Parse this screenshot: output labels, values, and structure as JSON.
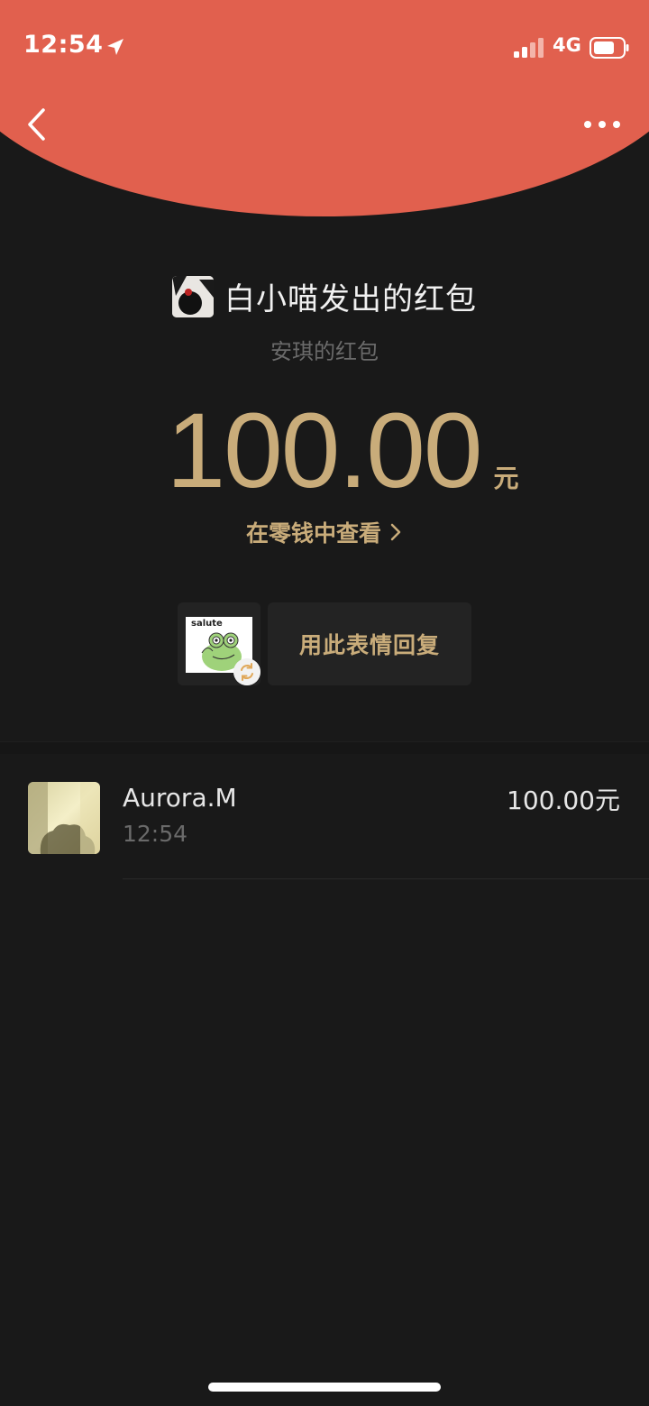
{
  "status_bar": {
    "time": "12:54",
    "network": "4G"
  },
  "nav": {
    "back_icon": "chevron-left-icon",
    "more_icon": "more-horizontal-icon"
  },
  "packet": {
    "sender_title": "白小喵发出的红包",
    "blessing": "安琪的红包",
    "amount": "100.00",
    "currency": "元",
    "view_in_change": "在零钱中查看"
  },
  "sticker_reply": {
    "sticker_caption": "salute",
    "reply_label": "用此表情回复"
  },
  "receivers": [
    {
      "name": "Aurora.M",
      "time": "12:54",
      "amount": "100.00元"
    }
  ],
  "colors": {
    "header_red": "#E1604E",
    "gold": "#C9AC7A",
    "background": "#191919"
  }
}
